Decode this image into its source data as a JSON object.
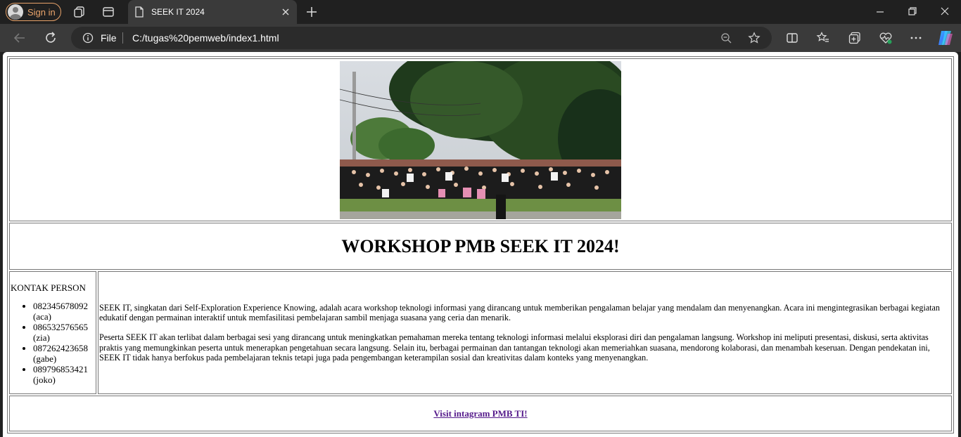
{
  "browser": {
    "signin_label": "Sign in",
    "tab_title": "SEEK IT 2024",
    "address_scheme": "File",
    "address_url": "C:/tugas%20pemweb/index1.html"
  },
  "page": {
    "photo_alt": "group photo",
    "heading": "WORKSHOP PMB SEEK IT 2024!",
    "contact": {
      "label": "KONTAK PERSON",
      "items": [
        {
          "phone": "082345678092",
          "name": "(aca)"
        },
        {
          "phone": "086532576565",
          "name": "(zia)"
        },
        {
          "phone": "087262423658",
          "name": "(gabe)"
        },
        {
          "phone": "089796853421",
          "name": "(joko)"
        }
      ]
    },
    "paragraphs": [
      "SEEK IT, singkatan dari Self-Exploration Experience Knowing, adalah acara workshop teknologi informasi yang dirancang untuk memberikan pengalaman belajar yang mendalam dan menyenangkan. Acara ini mengintegrasikan berbagai kegiatan edukatif dengan permainan interaktif untuk memfasilitasi pembelajaran sambil menjaga suasana yang ceria dan menarik.",
      "Peserta SEEK IT akan terlibat dalam berbagai sesi yang dirancang untuk meningkatkan pemahaman mereka tentang teknologi informasi melalui eksplorasi diri dan pengalaman langsung. Workshop ini meliputi presentasi, diskusi, serta aktivitas praktis yang memungkinkan peserta untuk menerapkan pengetahuan secara langsung. Selain itu, berbagai permainan dan tantangan teknologi akan memeriahkan suasana, mendorong kolaborasi, dan menambah keseruan. Dengan pendekatan ini, SEEK IT tidak hanya berfokus pada pembelajaran teknis tetapi juga pada pengembangan keterampilan sosial dan kreativitas dalam konteks yang menyenangkan."
    ],
    "link_text": "Visit intagram PMB TI!"
  },
  "colors": {
    "signin_accent": "#e8a36a",
    "link_visited": "#551a8b",
    "chrome_dark": "#202020",
    "chrome_mid": "#3a3a3a"
  },
  "icons": [
    "profile-avatar-icon",
    "collections-icon",
    "tab-actions-icon",
    "document-icon",
    "close-icon",
    "new-tab-icon",
    "minimize-icon",
    "restore-icon",
    "window-close-icon",
    "back-icon",
    "refresh-icon",
    "info-icon",
    "zoom-out-icon",
    "favorite-star-icon",
    "split-screen-icon",
    "favorites-icon",
    "collections-add-icon",
    "browser-essentials-icon",
    "more-icon",
    "copilot-icon"
  ]
}
